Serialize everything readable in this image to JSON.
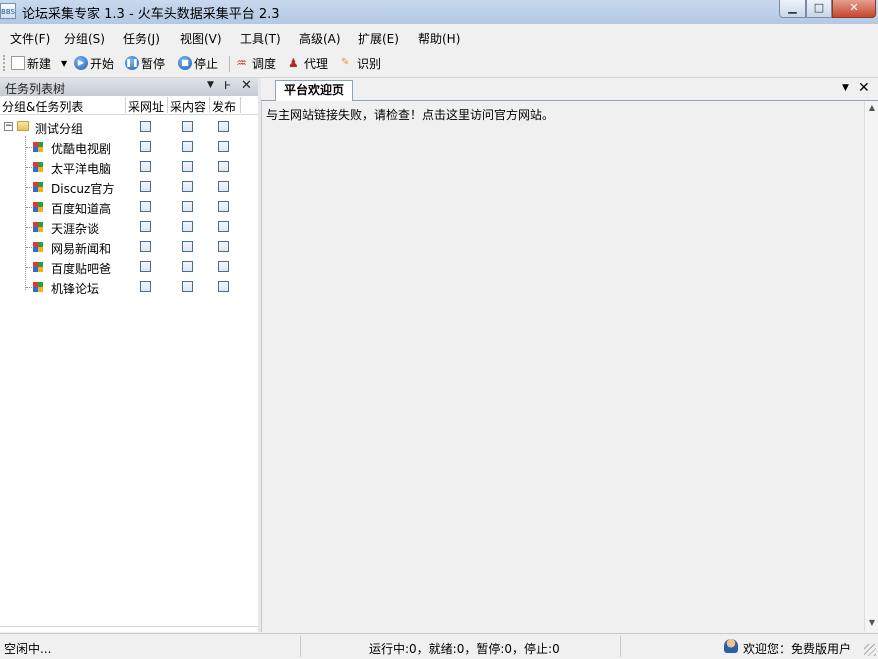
{
  "window": {
    "title": "论坛采集专家 1.3 - 火车头数据采集平台 2.3",
    "app_icon_text": "BBS",
    "minimize_icon": "minimize-icon",
    "maximize_icon": "maximize-icon",
    "close_icon": "close-icon"
  },
  "menu": [
    {
      "label": "文件(F)"
    },
    {
      "label": "分组(S)"
    },
    {
      "label": "任务(J)"
    },
    {
      "label": "视图(V)"
    },
    {
      "label": "工具(T)"
    },
    {
      "label": "高级(A)"
    },
    {
      "label": "扩展(E)"
    },
    {
      "label": "帮助(H)"
    }
  ],
  "toolbar": {
    "new": "新建",
    "start": "开始",
    "pause": "暂停",
    "stop": "停止",
    "schedule": "调度",
    "proxy": "代理",
    "recognize": "识别"
  },
  "left_panel": {
    "title": "任务列表树",
    "columns": [
      "分组&任务列表",
      "采网址",
      "采内容",
      "发布"
    ],
    "group": "测试分组",
    "tasks": [
      {
        "name": "优酷电视剧",
        "collect_url": false,
        "collect_content": false,
        "publish": false
      },
      {
        "name": "太平洋电脑",
        "collect_url": false,
        "collect_content": false,
        "publish": false
      },
      {
        "name": "Discuz官方",
        "collect_url": false,
        "collect_content": false,
        "publish": false
      },
      {
        "name": "百度知道高",
        "collect_url": false,
        "collect_content": false,
        "publish": false
      },
      {
        "name": "天涯杂谈",
        "collect_url": false,
        "collect_content": false,
        "publish": false
      },
      {
        "name": "网易新闻和",
        "collect_url": false,
        "collect_content": false,
        "publish": false
      },
      {
        "name": "百度贴吧爸",
        "collect_url": false,
        "collect_content": false,
        "publish": false
      },
      {
        "name": "机锋论坛",
        "collect_url": false,
        "collect_content": false,
        "publish": false
      }
    ]
  },
  "right_panel": {
    "tab": "平台欢迎页",
    "message": "与主网站链接失败，请检查！点击这里访问官方网站。"
  },
  "statusbar": {
    "left": "空闲中...",
    "counts": "运行中:0，就绪:0，暂停:0，停止:0",
    "user": "欢迎您：免费版用户"
  }
}
